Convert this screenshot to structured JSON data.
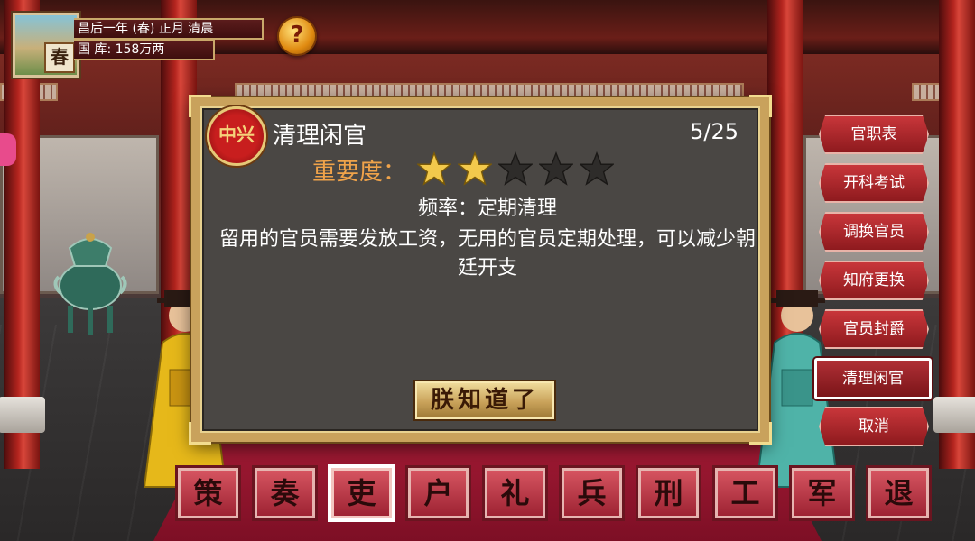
{
  "hud": {
    "season_glyph": "春",
    "date": "昌后一年 (春) 正月 清晨",
    "treasury": "国 库: 158万两",
    "help_label": "?"
  },
  "dialog": {
    "emblem_text": "中兴",
    "title": "清理闲官",
    "progress": "5/25",
    "importance_label": "重要度：",
    "importance_rating": 2,
    "importance_max": 5,
    "frequency": "频率：定期清理",
    "description": "留用的官员需要发放工资，无用的官员定期处理，可以减少朝廷开支",
    "confirm_label": "朕知道了"
  },
  "menu": {
    "items": [
      {
        "label": "官职表"
      },
      {
        "label": "开科考试"
      },
      {
        "label": "调换官员"
      },
      {
        "label": "知府更换"
      },
      {
        "label": "官员封爵"
      },
      {
        "label": "清理闲官",
        "active": true
      },
      {
        "label": "取消"
      }
    ]
  },
  "departments": {
    "items": [
      {
        "label": "策"
      },
      {
        "label": "奏"
      },
      {
        "label": "吏",
        "active": true
      },
      {
        "label": "户"
      },
      {
        "label": "礼"
      },
      {
        "label": "兵"
      },
      {
        "label": "刑"
      },
      {
        "label": "工"
      },
      {
        "label": "军"
      },
      {
        "label": "退"
      }
    ]
  },
  "colors": {
    "star_filled": "#f2c94c",
    "star_empty": "#2e2c2a",
    "importance_label": "#f0a34a",
    "menu_red": "#b32a30"
  }
}
